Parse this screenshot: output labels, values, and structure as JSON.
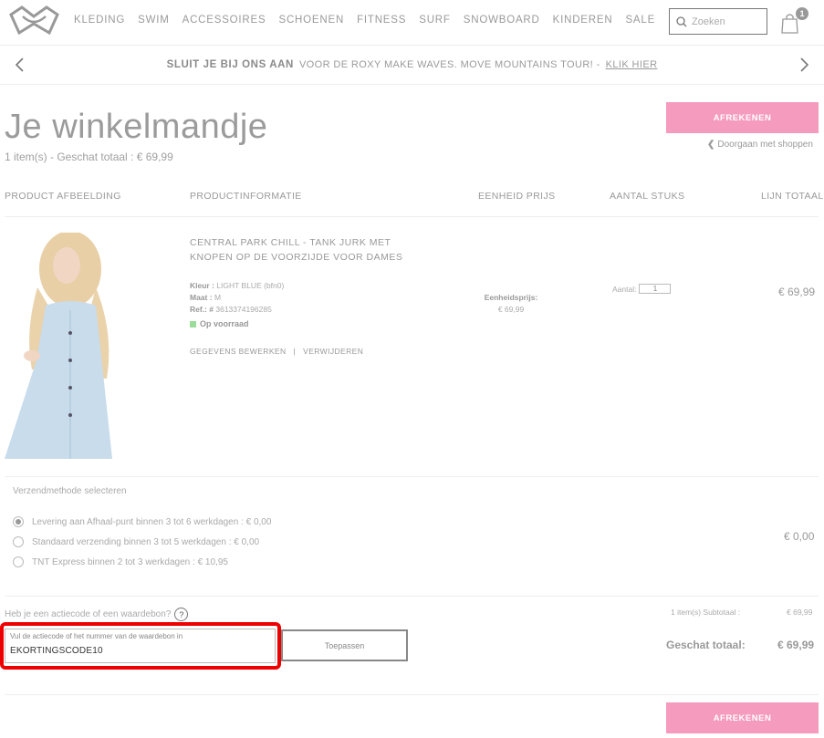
{
  "header": {
    "nav_items": [
      "KLEDING",
      "SWIM",
      "ACCESSOIRES",
      "SCHOENEN",
      "FITNESS",
      "SURF",
      "SNOWBOARD",
      "KINDEREN",
      "SALE"
    ],
    "search_placeholder": "Zoeken",
    "cart_count": "1"
  },
  "promo": {
    "bold": "SLUIT JE BIJ ONS AAN",
    "text": "VOOR DE ROXY MAKE WAVES. MOVE MOUNTAINS TOUR! -",
    "link": "KLIK HIER"
  },
  "cart": {
    "title": "Je winkelmandje",
    "summary": "1 item(s) - Geschat totaal : € 69,99",
    "checkout_label": "AFREKENEN",
    "continue_label": "Doorgaan met shoppen"
  },
  "table": {
    "headers": [
      "PRODUCT AFBEELDING",
      "PRODUCTINFORMATIE",
      "EENHEID PRIJS",
      "AANTAL STUKS",
      "LIJN TOTAAL"
    ]
  },
  "product": {
    "name": "CENTRAL PARK CHILL - TANK JURK MET KNOPEN OP DE VOORZIJDE VOOR DAMES",
    "color_label": "Kleur :",
    "color_value": "LIGHT BLUE (bfn0)",
    "size_label": "Maat :",
    "size_value": "M",
    "ref_label": "Ref.: #",
    "ref_value": "3613374196285",
    "stock": "Op voorraad",
    "edit_link": "GEGEVENS BEWERKEN",
    "remove_link": "VERWIJDEREN",
    "unit_price_label": "Eenheidsprijs:",
    "unit_price": "€ 69,99",
    "qty_label": "Aantal:",
    "qty_value": "1",
    "line_total": "€ 69,99"
  },
  "shipping": {
    "title": "Verzendmethode selecteren",
    "options": [
      {
        "label": "Levering aan Afhaal-punt binnen 3 tot 6 werkdagen : € 0,00",
        "selected": true
      },
      {
        "label": "Standaard verzending binnen 3 tot 5 werkdagen : € 0,00",
        "selected": false
      },
      {
        "label": "TNT Express binnen 2 tot 3 werkdagen : € 10,95",
        "selected": false
      }
    ],
    "price": "€ 0,00"
  },
  "voucher": {
    "question": "Heb je een actiecode of een waardebon?",
    "help": "?",
    "field_label": "Vul de actiecode of het nummer van de waardebon in",
    "field_value": "EKORTINGSCODE10",
    "apply_label": "Toepassen"
  },
  "totals": {
    "subtotal_label": "1 item(s) Subtotaal :",
    "subtotal_value": "€ 69,99",
    "total_label": "Geschat totaal:",
    "total_value": "€ 69,99"
  },
  "colors": {
    "accent": "#f59bbd",
    "highlight": "#e00000",
    "stock": "#9bdc9b"
  }
}
